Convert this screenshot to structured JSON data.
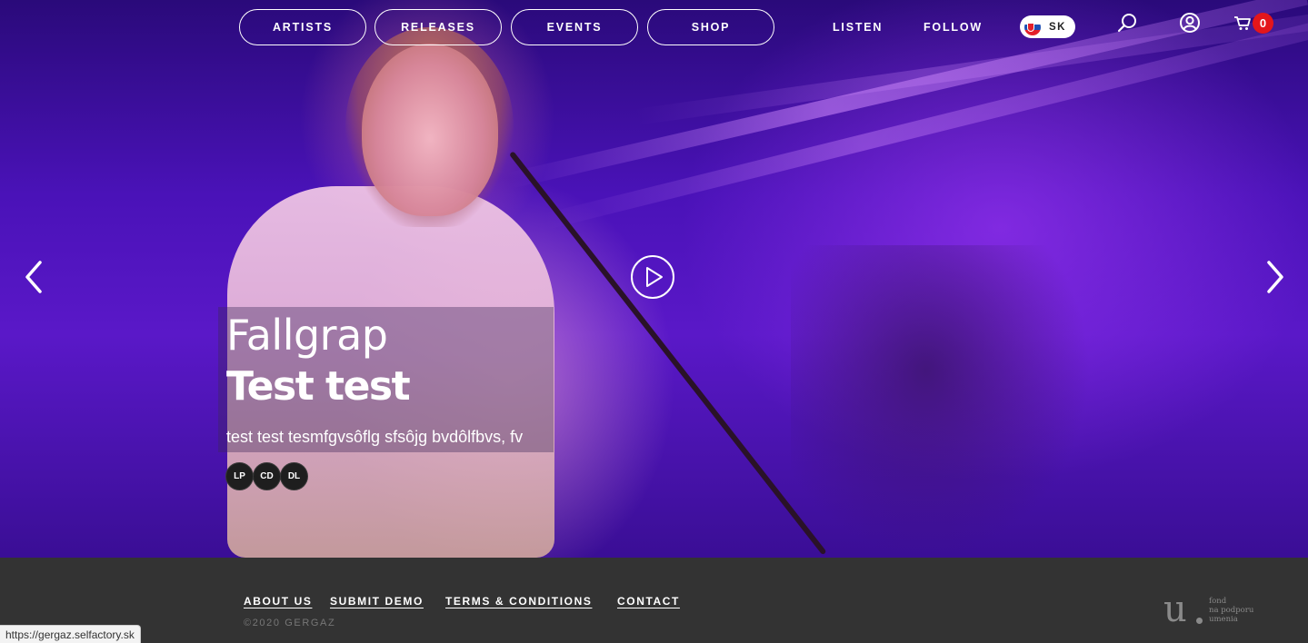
{
  "nav": {
    "pills": [
      {
        "label": "ARTISTS"
      },
      {
        "label": "RELEASES"
      },
      {
        "label": "EVENTS"
      },
      {
        "label": "SHOP"
      }
    ],
    "links": [
      {
        "label": "LISTEN"
      },
      {
        "label": "FOLLOW"
      }
    ],
    "language": {
      "code": "SK",
      "flag": "slovakia-flag-icon"
    },
    "icons": [
      "search-icon",
      "user-icon",
      "cart-icon"
    ],
    "cart_count": "0",
    "cart_badge_color": "#e4161b"
  },
  "hero": {
    "title": "Fallgrap",
    "subtitle": "Test test",
    "description": "test test tesmfgvsôflg sfsôjg bvdôlfbvs, fv",
    "formats": [
      "LP",
      "CD",
      "DL"
    ],
    "icons": [
      "chevron-left-icon",
      "chevron-right-icon",
      "play-icon"
    ],
    "accent_color": "#5a18c8"
  },
  "footer": {
    "links": [
      {
        "label": "ABOUT US"
      },
      {
        "label": "SUBMIT DEMO"
      },
      {
        "label": "TERMS & CONDITIONS"
      },
      {
        "label": "CONTACT"
      }
    ],
    "copyright": "©2020 GERGAZ",
    "fund_logo": {
      "mark": "u",
      "lines": [
        "fond",
        "na podporu",
        "umenia"
      ]
    },
    "background_color": "#333333"
  },
  "status_bar": {
    "url": "https://gergaz.selfactory.sk"
  }
}
